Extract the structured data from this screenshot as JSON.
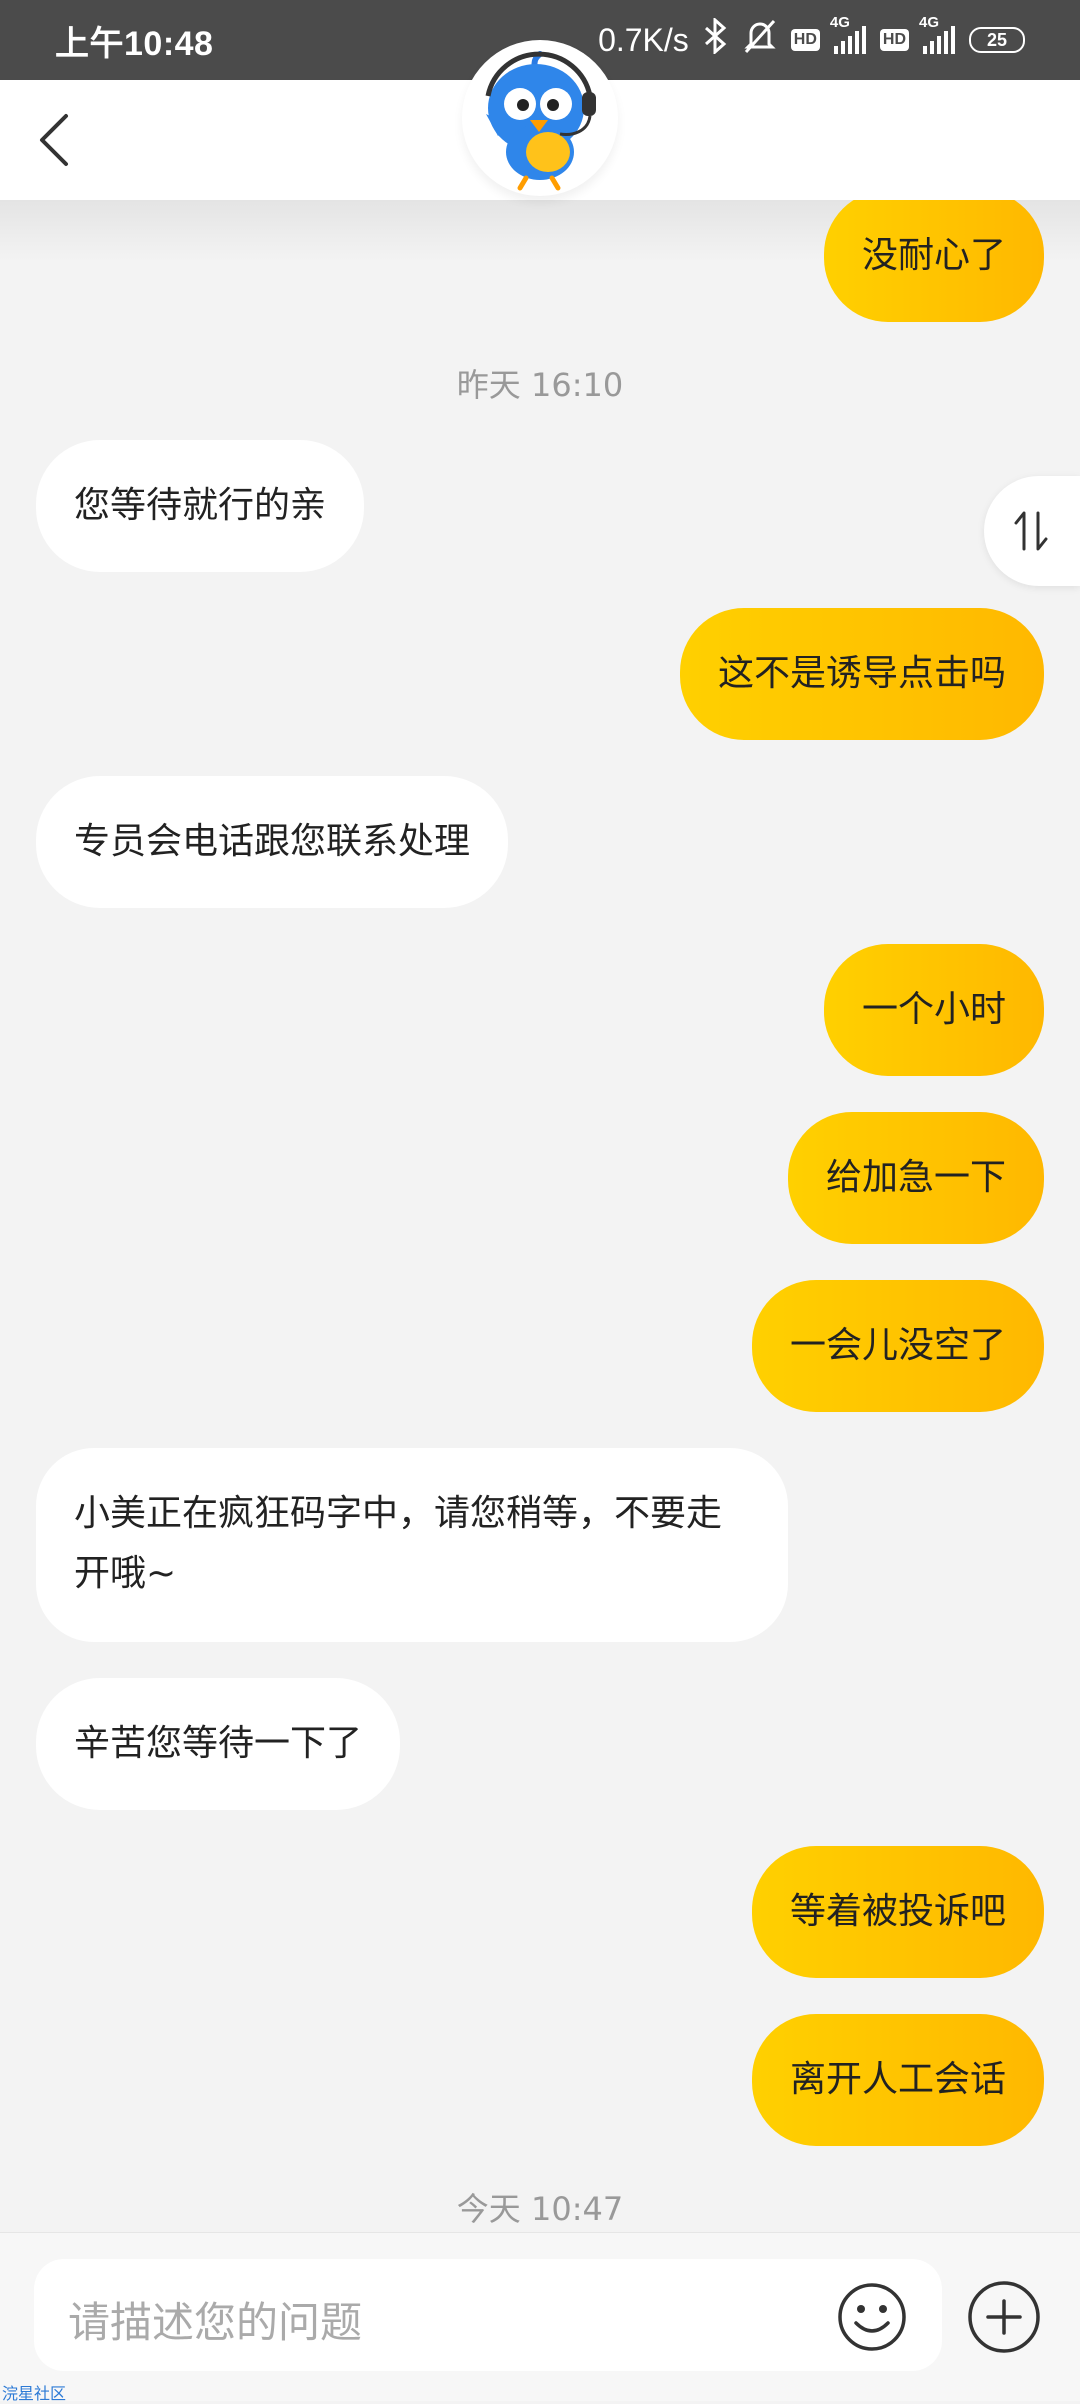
{
  "status_bar": {
    "time": "上午10:48",
    "network_speed": "0.7K/s",
    "sim1_hd": "HD",
    "sim1_type": "4G",
    "sim2_hd": "HD",
    "sim2_type": "4G",
    "battery": "25"
  },
  "header": {
    "back_icon": "chevron-left-icon",
    "avatar_icon": "bird-mascot-icon"
  },
  "chat": {
    "messages": [
      {
        "side": "out",
        "text": "没耐心了"
      },
      {
        "side": "time",
        "text": "昨天 16:10"
      },
      {
        "side": "in",
        "text": "您等待就行的亲"
      },
      {
        "side": "out",
        "text": "这不是诱导点击吗"
      },
      {
        "side": "in",
        "text": "专员会电话跟您联系处理"
      },
      {
        "side": "out",
        "text": "一个小时"
      },
      {
        "side": "out",
        "text": "给加急一下"
      },
      {
        "side": "out",
        "text": "一会儿没空了"
      },
      {
        "side": "in",
        "text": "小美正在疯狂码字中，请您稍等，不要走开哦~"
      },
      {
        "side": "in",
        "text": "辛苦您等待一下了"
      },
      {
        "side": "out",
        "text": "等着被投诉吧"
      },
      {
        "side": "out",
        "text": "离开人工会话"
      },
      {
        "side": "time",
        "text": "今天 10:47"
      }
    ]
  },
  "input": {
    "placeholder": "请描述您的问题",
    "emoji_icon": "smiley-icon",
    "plus_icon": "plus-circle-icon"
  },
  "watermark": "浣星社区",
  "colors": {
    "bubble_out_start": "#ffd000",
    "bubble_out_end": "#ffb800",
    "bubble_in": "#ffffff",
    "background": "#f3f3f3",
    "status_bar": "#4b4b4b"
  }
}
